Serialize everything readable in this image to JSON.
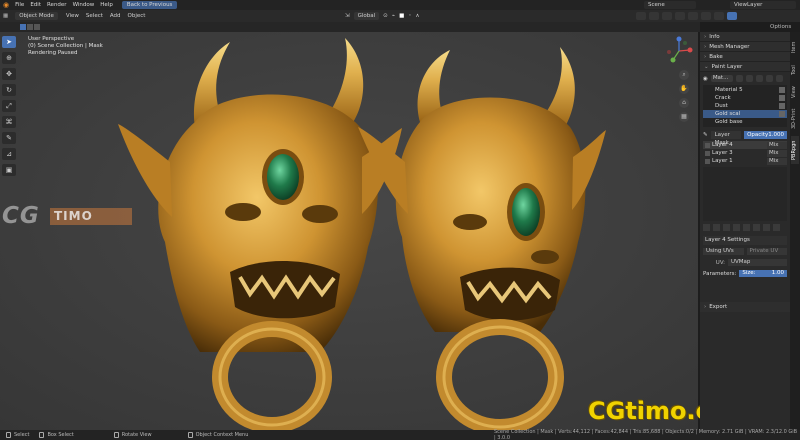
{
  "topbar": {
    "menu": [
      "File",
      "Edit",
      "Render",
      "Window",
      "Help"
    ],
    "back_label": "Back to Previous",
    "scene": "Scene",
    "view_layer": "ViewLayer"
  },
  "header": {
    "mode": "Object Mode",
    "menus": [
      "View",
      "Select",
      "Add",
      "Object"
    ],
    "orientation": "Global",
    "options": "Options"
  },
  "viewport": {
    "overlay": [
      "User Perspective",
      "(0) Scene Collection | Mask",
      "Rendering Paused"
    ],
    "watermark_cg": "CG",
    "watermark_timo": "TIMO",
    "brand": "CGtimo.com"
  },
  "npanel": {
    "sections": {
      "info": "Info",
      "mesh_manager": "Mesh Manager",
      "bake": "Bake",
      "paint_layer": "Paint Layer",
      "export": "Export"
    },
    "material_dd": "Mat...",
    "materials": [
      {
        "name": "Material 5",
        "selected": false
      },
      {
        "name": "Crack",
        "selected": false
      },
      {
        "name": "Dust",
        "selected": false
      },
      {
        "name": "Gold scal",
        "selected": true
      },
      {
        "name": "Gold base",
        "selected": false
      }
    ],
    "layer_mask_label": "Layer Mask",
    "opacity_label": "Opacity",
    "opacity_value": "1.000",
    "layers": [
      {
        "name": "Layer 4",
        "blend": "Mix",
        "selected": true
      },
      {
        "name": "Layer 3",
        "blend": "Mix",
        "selected": false
      },
      {
        "name": "Layer 1",
        "blend": "Mix",
        "selected": false
      }
    ],
    "layer_settings_title": "Layer 4 Settings",
    "using_uvs": "Using UVs",
    "private_uv": "Private UV",
    "uv_key": "UV:",
    "uv_value": "UVMap",
    "parameters_label": "Parameters:",
    "size_label": "Size:",
    "size_value": "1.00"
  },
  "rtabs": [
    "Item",
    "Tool",
    "View",
    "3D-Print",
    "PBRpgn"
  ],
  "status": {
    "select": "Select",
    "box_select": "Box Select",
    "rotate_view": "Rotate View",
    "context_menu": "Object Context Menu",
    "stats": "Scene Collection | Mask | Verts:44,112 | Faces:42,844 | Tris:85,688 | Objects:0/2 | Memory: 2.71 GiB | VRAM: 2.3/12.0 GiB | 3.0.0"
  },
  "colors": {
    "accent": "#4772b3",
    "gold": "#c8902a",
    "gem": "#1f7a4a",
    "brand": "#f0d200"
  }
}
